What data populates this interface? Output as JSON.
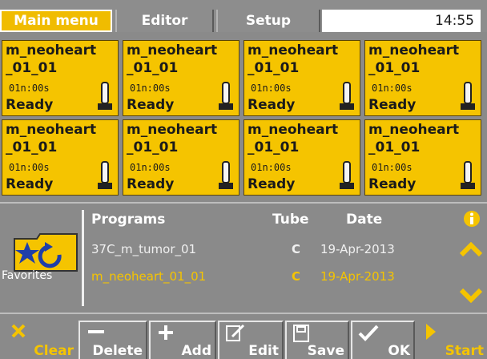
{
  "tabs": {
    "main_menu": "Main menu",
    "editor": "Editor",
    "setup": "Setup"
  },
  "clock": "14:55",
  "tiles": [
    {
      "name": "m_neoheart\n_01_01",
      "time": "01n:00s",
      "status": "Ready"
    },
    {
      "name": "m_neoheart\n_01_01",
      "time": "01n:00s",
      "status": "Ready"
    },
    {
      "name": "m_neoheart\n_01_01",
      "time": "01n:00s",
      "status": "Ready"
    },
    {
      "name": "m_neoheart\n_01_01",
      "time": "01n:00s",
      "status": "Ready"
    },
    {
      "name": "m_neoheart\n_01_01",
      "time": "01n:00s",
      "status": "Ready"
    },
    {
      "name": "m_neoheart\n_01_01",
      "time": "01n:00s",
      "status": "Ready"
    },
    {
      "name": "m_neoheart\n_01_01",
      "time": "01n:00s",
      "status": "Ready"
    },
    {
      "name": "m_neoheart\n_01_01",
      "time": "01n:00s",
      "status": "Ready"
    }
  ],
  "programs": {
    "favorites_label": "Favorites",
    "headers": {
      "programs": "Programs",
      "tube": "Tube",
      "date": "Date"
    },
    "rows": [
      {
        "name": "37C_m_tumor_01",
        "tube": "C",
        "date": "19-Apr-2013",
        "selected": false
      },
      {
        "name": "m_neoheart_01_01",
        "tube": "C",
        "date": "19-Apr-2013",
        "selected": true
      }
    ]
  },
  "toolbar": {
    "clear": "Clear",
    "delete": "Delete",
    "add": "Add",
    "edit": "Edit",
    "save": "Save",
    "ok": "OK",
    "start": "Start"
  },
  "colors": {
    "accent": "#f5c400",
    "panel": "#8a8a8a",
    "text_light": "#ffffff"
  },
  "icons": {
    "tube": "tube-icon",
    "favorites": "favorites-folder-icon",
    "info": "info-icon",
    "up": "chevron-up-icon",
    "down": "chevron-down-icon"
  }
}
